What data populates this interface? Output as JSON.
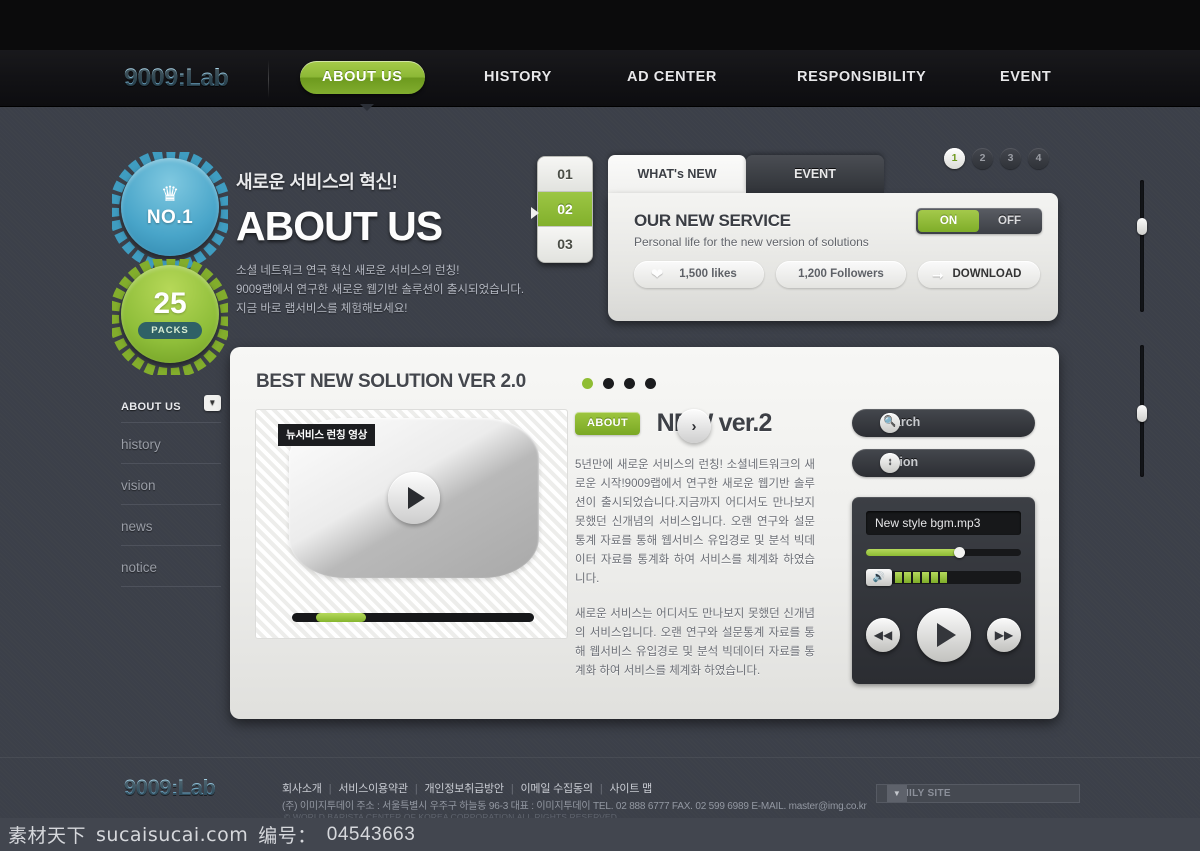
{
  "site": {
    "logo": "9009:Lab"
  },
  "nav": {
    "items": [
      {
        "label": "ABOUT US",
        "active": true
      },
      {
        "label": "HISTORY",
        "active": false
      },
      {
        "label": "AD CENTER",
        "active": false
      },
      {
        "label": "RESPONSIBILITY",
        "active": false
      },
      {
        "label": "EVENT",
        "active": false
      }
    ]
  },
  "badges": {
    "blue": {
      "icon": "trophy-icon",
      "label": "NO.1"
    },
    "green": {
      "number": "25",
      "label": "PACKS"
    }
  },
  "hero": {
    "kicker": "새로운 서비스의 혁신!",
    "title": "ABOUT US",
    "desc_line1": "소셜 네트워크 연국 혁신 새로운 서비스의 런칭!",
    "desc_line2": "9009랩에서 연구한 새로운 웹기반 솔루션이 출시되었습니다.",
    "desc_line3": "지금 바로 랩서비스를 체험해보세요!"
  },
  "steps": [
    {
      "label": "01",
      "active": false
    },
    {
      "label": "02",
      "active": true
    },
    {
      "label": "03",
      "active": false
    }
  ],
  "whats_new": {
    "tabs": [
      {
        "label": "WHAT's NEW",
        "active": true
      },
      {
        "label": "EVENT",
        "active": false
      }
    ],
    "title": "OUR NEW SERVICE",
    "subtitle": "Personal life for the new version of solutions",
    "likes": "1,500 likes",
    "followers": "1,200 Followers",
    "download": "DOWNLOAD",
    "toggle": {
      "on": "ON",
      "off": "OFF",
      "state": "ON"
    },
    "accent_color": "#8cb836"
  },
  "pager": {
    "items": [
      {
        "label": "1",
        "active": true
      },
      {
        "label": "2",
        "active": false
      },
      {
        "label": "3",
        "active": false
      },
      {
        "label": "4",
        "active": false
      }
    ]
  },
  "sidebar": {
    "header": "ABOUT US",
    "items": [
      {
        "label": "history"
      },
      {
        "label": "vision"
      },
      {
        "label": "news"
      },
      {
        "label": "notice"
      }
    ]
  },
  "card": {
    "title": "BEST NEW SOLUTION VER 2.0",
    "dots": [
      {
        "active": true
      },
      {
        "active": false
      },
      {
        "active": false
      },
      {
        "active": false
      }
    ],
    "video": {
      "label": "뉴서비스 런칭 영상",
      "progress_percent": 21
    },
    "about_tag": "ABOUT",
    "headline": "NEW ver.2",
    "paragraph1": "5년만에 새로운 서비스의 런칭! 소셜네트워크의 새로운 시작!9009랩에서 연구한 새로운 웹기반 솔루션이 출시되었습니다.지금까지 어디서도 만나보지 못했던 신개념의 서비스입니다. 오랜 연구와 설문통계 자료를 통해 웹서비스 유입경로 및 분석 빅데이터 자료를 통계화 하여 서비스를 체계화 하였습니다.",
    "paragraph2": "새로운 서비스는 어디서도 만나보지 못했던 신개념의 서비스입니다. 오랜 연구와 설문통계 자료를 통해 웹서비스 유입경로 및 분석 빅데이터 자료를 통계화 하여 서비스를 체계화 하였습니다."
  },
  "tools": {
    "search_label": "search",
    "search_icon": "magnifier-icon",
    "option_label": "option",
    "option_icon": "up-down-arrows-icon"
  },
  "player": {
    "track": "New style bgm.mp3",
    "seek_percent": 60,
    "volume_bars": 6,
    "volume_icon": "speaker-icon",
    "prev_icon": "rewind-icon",
    "play_icon": "play-icon",
    "next_icon": "fast-forward-icon"
  },
  "footer": {
    "logo": "9009:Lab",
    "links": [
      "회사소개",
      "서비스이용약관",
      "개인정보취급방안",
      "이메일 수집동의",
      "사이트 맵"
    ],
    "address": "(주) 이미지투데이   주소 : 서울특별시 우주구 하늘동 96-3   대표 : 이미지투데이  TEL. 02 888 6777  FAX. 02 599 6989 E-MAIL. master@img.co.kr",
    "copyright": "© WORLD BARISTA CENTER OF KOREA CORPORATION.ALL RIGHTS RESERVED.",
    "family_site": "FAMILY SITE"
  },
  "watermark": {
    "brand": "素材天下",
    "site": "sucaisucai.com",
    "id_label": "编号：",
    "id_value": "04543663"
  }
}
